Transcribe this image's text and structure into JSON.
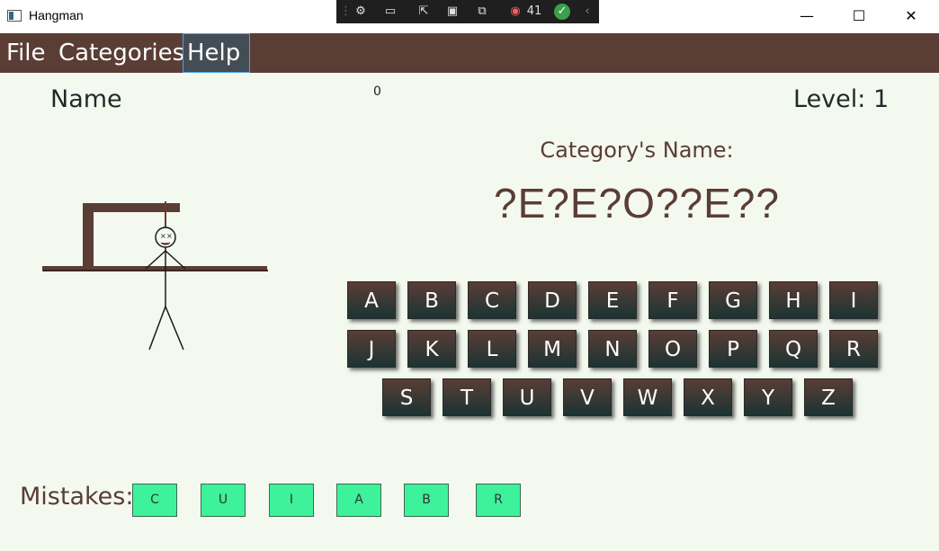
{
  "window": {
    "title": "Hangman"
  },
  "debug_toolbar": {
    "counter": "41"
  },
  "menu": {
    "items": [
      "File",
      "Categories",
      "Help"
    ]
  },
  "game": {
    "player_name": "Name",
    "score": "0",
    "level": "Level: 1",
    "category_label": "Category's Name:",
    "masked_word": "?E?E?O??E??"
  },
  "keyboard": {
    "rows": [
      [
        "A",
        "B",
        "C",
        "D",
        "E",
        "F",
        "G",
        "H",
        "I"
      ],
      [
        "J",
        "K",
        "L",
        "M",
        "N",
        "O",
        "P",
        "Q",
        "R"
      ],
      [
        "S",
        "T",
        "U",
        "V",
        "W",
        "X",
        "Y",
        "Z"
      ]
    ]
  },
  "mistakes": {
    "label": "Mistakes:",
    "letters": [
      "C",
      "U",
      "I",
      "A",
      "B",
      "R"
    ]
  },
  "colors": {
    "menubar": "#5a3d34",
    "background": "#f4f9ef",
    "key_top": "#5a3d34",
    "key_bottom": "#1b3433",
    "mistake_box": "#3df29a"
  }
}
